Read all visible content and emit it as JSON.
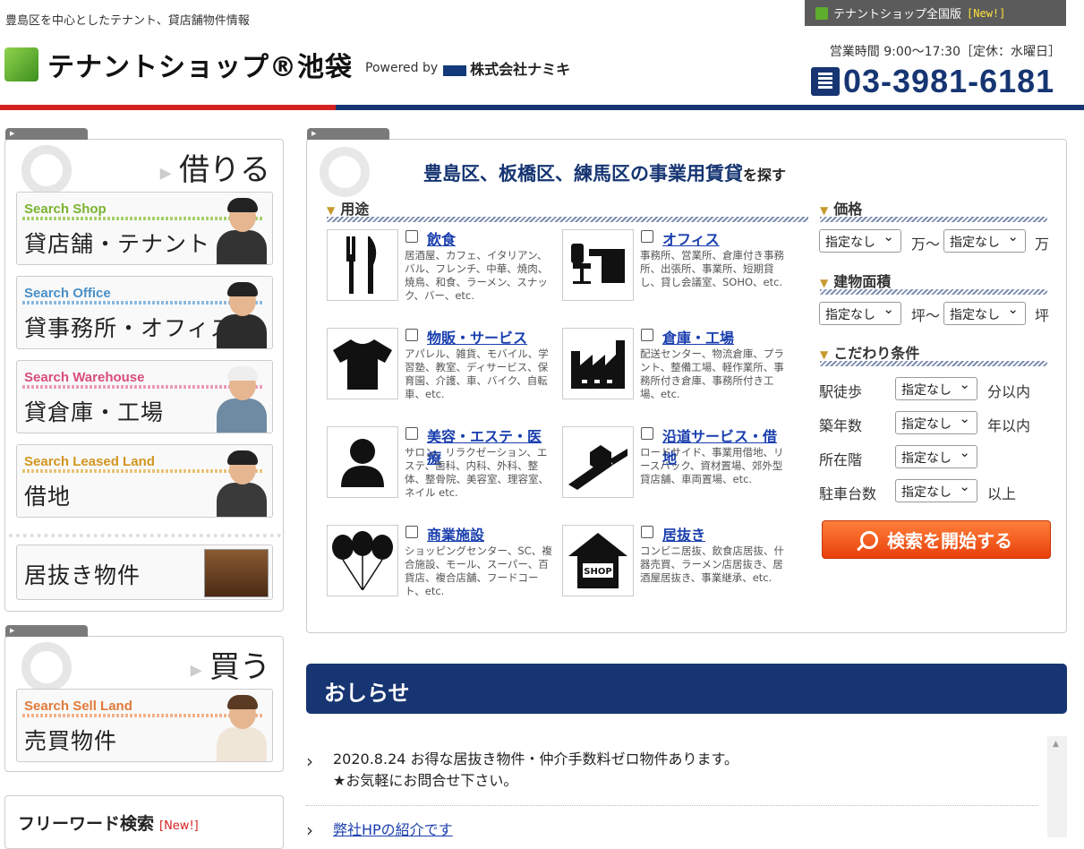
{
  "header": {
    "tagline": "豊島区を中心としたテナント、貸店舗物件情報",
    "national_label": "テナントショップ全国版",
    "national_badge": "[New!]",
    "logo_text": "テナントショップ®池袋",
    "powered_by": "Powered by",
    "company": "株式会社ナミキ",
    "hours": "営業時間 9:00～17:30［定休：水曜日］",
    "phone": "03-3981-6181"
  },
  "left_rent": {
    "title": "借りる",
    "buttons": [
      {
        "en": "Search Shop",
        "jp": "貸店舗・テナント",
        "color": "#7ab32e"
      },
      {
        "en": "Search Office",
        "jp": "貸事務所・オフィス",
        "color": "#4a8fc7"
      },
      {
        "en": "Search Warehouse",
        "jp": "貸倉庫・工場",
        "color": "#d94d7a"
      },
      {
        "en": "Search Leased Land",
        "jp": "借地",
        "color": "#d2951e"
      }
    ],
    "inuki": "居抜き物件"
  },
  "left_buy": {
    "title": "買う",
    "button": {
      "en": "Search Sell Land",
      "jp": "売買物件",
      "color": "#e07a3c"
    }
  },
  "free_word": {
    "title": "フリーワード検索",
    "badge": "[New!]"
  },
  "main": {
    "heading": "豊島区、板橋区、練馬区の事業用賃貸",
    "heading_suffix": "を探す",
    "purpose_label": "用途",
    "categories": [
      {
        "icon": "fork-knife-icon",
        "name": "飲食",
        "desc": "居酒屋、カフェ、イタリアン、バル、フレンチ、中華、焼肉、焼鳥、和食、ラーメン、スナック、バー、etc."
      },
      {
        "icon": "office-desk-icon",
        "name": "オフィス",
        "desc": "事務所、営業所、倉庫付き事務所、出張所、事業所、短期貸し、貸し会議室、SOHO、etc."
      },
      {
        "icon": "tshirt-icon",
        "name": "物販・サービス",
        "desc": "アパレル、雑貨、モバイル、学習塾、教室、ディサービス、保育園、介護、車、バイク、自転車、etc."
      },
      {
        "icon": "factory-icon",
        "name": "倉庫・工場",
        "desc": "配送センター、物流倉庫、プラント、整備工場、軽作業所、事務所付き倉庫、事務所付き工場、etc."
      },
      {
        "icon": "person-icon",
        "name": "美容・エステ・医療",
        "desc": "サロン、リラクゼーション、エステ、歯科、内科、外科、整体、整骨院、美容室、理容室、ネイル etc."
      },
      {
        "icon": "roadside-icon",
        "name": "沿道サービス・借地",
        "desc": "ロードサイド、事業用借地、リースバック、資材置場、郊外型貸店舗、車両置場、etc."
      },
      {
        "icon": "balloons-icon",
        "name": "商業施設",
        "desc": "ショッピングセンター、SC、複合施設、モール、スーパー、百貨店、複合店舗、フードコート、etc."
      },
      {
        "icon": "shop-house-icon",
        "name": "居抜き",
        "desc": "コンビニ居抜、飲食店居抜、什器売買、ラーメン店居抜き、居酒屋居抜き、事業継承、etc."
      }
    ],
    "price": {
      "label": "価格",
      "from": "指定なし",
      "to": "指定なし",
      "unit1": "万～",
      "unit2": "万"
    },
    "area": {
      "label": "建物面積",
      "from": "指定なし",
      "to": "指定なし",
      "unit1": "坪～",
      "unit2": "坪"
    },
    "conditions": {
      "label": "こだわり条件",
      "rows": [
        {
          "label": "駅徒歩",
          "value": "指定なし",
          "unit": "分以内"
        },
        {
          "label": "築年数",
          "value": "指定なし",
          "unit": "年以内"
        },
        {
          "label": "所在階",
          "value": "指定なし",
          "unit": ""
        },
        {
          "label": "駐車台数",
          "value": "指定なし",
          "unit": "以上"
        }
      ]
    },
    "search_button": "検索を開始する"
  },
  "news": {
    "title": "おしらせ",
    "items": [
      {
        "line1": "2020.8.24 お得な居抜き物件・仲介手数料ゼロ物件あります。",
        "line2": "★お気軽にお問合せ下さい。"
      },
      {
        "link": "弊社HPの紹介です"
      }
    ]
  }
}
